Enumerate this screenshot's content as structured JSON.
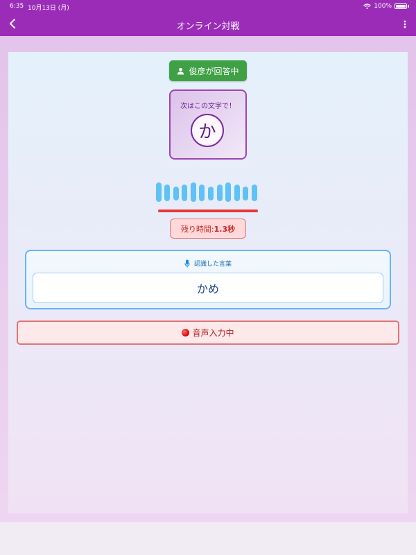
{
  "status_bar": {
    "time": "6:35",
    "date": "10月13日 (月)",
    "battery": "100%"
  },
  "header": {
    "title": "オンライン対戦"
  },
  "player": {
    "answering_label": "俊彦が回答中"
  },
  "next_char": {
    "label": "次はこの文字で！",
    "char": "か"
  },
  "timer": {
    "label": "残り時間: ",
    "value": "1.3秒"
  },
  "recognized": {
    "header": "認識した言葉",
    "word": "かめ"
  },
  "voice": {
    "status": "音声入力中"
  },
  "colors": {
    "app_bar": "#9b2cb8",
    "answering_green": "#3fa046",
    "accent_purple": "#9c44b6",
    "wave_blue": "#5ec2f5",
    "alert_red": "#e53935",
    "recog_blue": "#64b5f6"
  },
  "icons": {
    "back": "chevron-left-icon",
    "menu": "more-vertical-icon",
    "person": "person-icon",
    "mic": "microphone-icon",
    "record": "record-dot-icon"
  }
}
